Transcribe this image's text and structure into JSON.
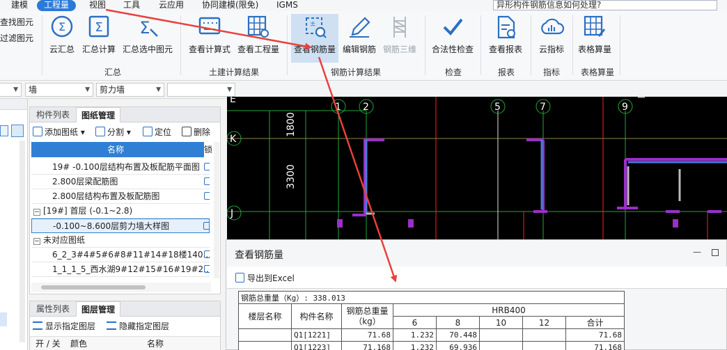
{
  "menu": {
    "items": [
      "建模",
      "工程量",
      "视图",
      "工具",
      "云应用",
      "协同建模(限免)",
      "IGMS"
    ],
    "active": "工程量"
  },
  "search": {
    "value": "异形构件钢筋信息如何处理?"
  },
  "ribbon": {
    "small_buttons": [
      "查找图元",
      "过滤图元"
    ],
    "groups": [
      {
        "label": "汇总",
        "buttons": [
          "云汇总",
          "汇总计算",
          "汇总选中图元"
        ]
      },
      {
        "label": "土建计算结果",
        "buttons": [
          "查看计算式",
          "查看工程量"
        ]
      },
      {
        "label": "钢筋计算结果",
        "buttons": [
          "查看钢筋量",
          "编辑钢筋",
          "钢筋三维"
        ]
      },
      {
        "label": "检查",
        "buttons": [
          "合法性检查"
        ]
      },
      {
        "label": "报表",
        "buttons": [
          "查看报表"
        ]
      },
      {
        "label": "指标",
        "buttons": [
          "云指标"
        ]
      },
      {
        "label": "表格算量",
        "buttons": [
          "表格算量"
        ]
      }
    ]
  },
  "selectors": {
    "element_type": "墙",
    "element_sub": "剪力墙",
    "blank": ""
  },
  "drawing_panel": {
    "tabs": [
      "构件列表",
      "图纸管理"
    ],
    "active_tab": "图纸管理",
    "tools": [
      "添加图纸",
      "分割",
      "定位",
      "删除"
    ],
    "columns": [
      "名称",
      "锁"
    ],
    "rows": [
      {
        "text": "19# -0.100层结构布置及板配筋平面图",
        "indent": 1
      },
      {
        "text": "2.800层梁配筋图",
        "indent": 1
      },
      {
        "text": "2.800层结构布置及板配筋图",
        "indent": 1
      },
      {
        "text": "[19#] 首层 (-0.1~2.8)",
        "indent": 0,
        "toggle": "−"
      },
      {
        "text": "-0.100~8.600层剪力墙大样图",
        "indent": 1,
        "selected": true
      },
      {
        "text": "未对应图纸",
        "indent": 0,
        "toggle": "−"
      },
      {
        "text": "6_2_3#4#5#6#8#11#14#18楼140...",
        "indent": 1
      },
      {
        "text": "1_1_1_5_西水湖9#12#15#16#19#2...",
        "indent": 1
      }
    ]
  },
  "property_panel": {
    "tabs": [
      "属性列表",
      "图层管理"
    ],
    "active_tab": "图层管理",
    "actions": [
      "显示指定图层",
      "隐藏指定图层"
    ],
    "columns": [
      "开 / 关",
      "颜色",
      "名称"
    ]
  },
  "cad": {
    "axis_numbers": [
      "1",
      "2",
      "5",
      "7",
      "9"
    ],
    "axis_letters": [
      "E",
      "K",
      "J"
    ],
    "dimensions": [
      "1800",
      "3300"
    ]
  },
  "dialog": {
    "title": "查看钢筋量",
    "export_label": "导出到Excel",
    "table": {
      "total_label": "钢筋总重量（Kg）: 338.013",
      "headers": {
        "floor": "楼层名称",
        "component": "构件名称",
        "total_weight": "钢筋总重量",
        "unit": "（kg）",
        "grade": "HRB400"
      },
      "diameters": [
        "6",
        "8",
        "10",
        "12",
        "合计"
      ],
      "rows": [
        {
          "floor": "",
          "component": "Q1[1221]",
          "total": "71.68",
          "d6": "1.232",
          "d8": "70.448",
          "d10": "",
          "d12": "",
          "sum": "71.68"
        },
        {
          "floor": "",
          "component": "Q1[1223]",
          "total": "71.168",
          "d6": "1.232",
          "d8": "69.936",
          "d10": "",
          "d12": "",
          "sum": "71.168"
        }
      ]
    }
  },
  "colors": {
    "accent": "#2b7ad9",
    "annotation_arrow": "#e8413c",
    "cad_background": "#000000"
  }
}
